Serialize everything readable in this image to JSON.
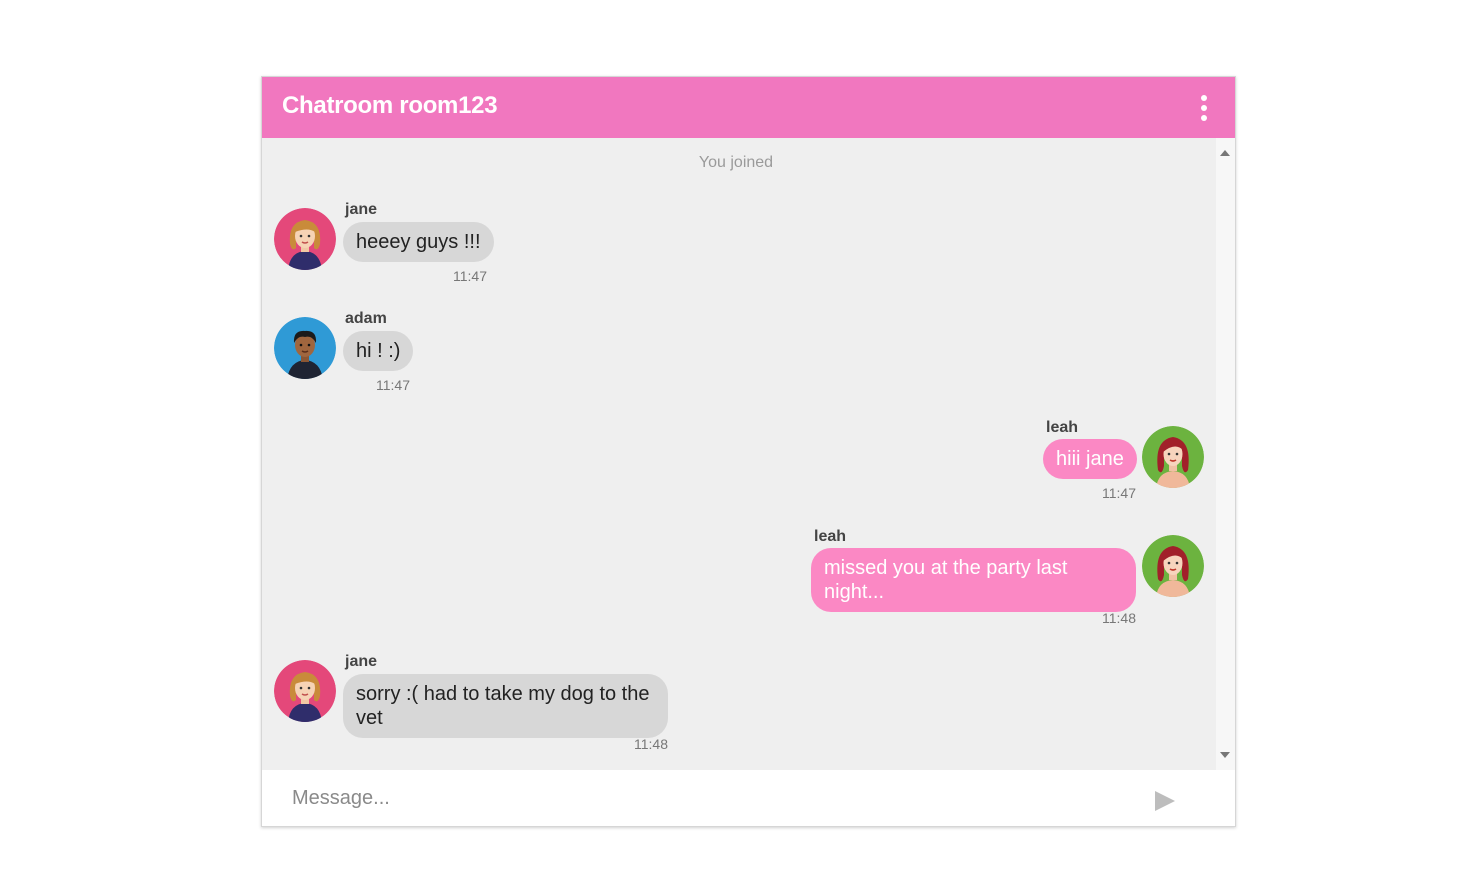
{
  "header": {
    "title": "Chatroom room123",
    "menu_icon": "more-vertical-icon",
    "color": "#f177bf"
  },
  "system_message": "You joined",
  "messages": [
    {
      "sender": "jane",
      "text": "heeey guys !!!",
      "time": "11:47",
      "direction": "in",
      "avatar": "jane-avatar"
    },
    {
      "sender": "adam",
      "text": "hi ! :)",
      "time": "11:47",
      "direction": "in",
      "avatar": "adam-avatar"
    },
    {
      "sender": "leah",
      "text": "hiii jane",
      "time": "11:47",
      "direction": "out",
      "avatar": "leah-avatar"
    },
    {
      "sender": "leah",
      "text": "missed you at the party last night...",
      "time": "11:48",
      "direction": "out",
      "avatar": "leah-avatar"
    },
    {
      "sender": "jane",
      "text": "sorry :( had to take my dog to the vet",
      "time": "11:48",
      "direction": "in",
      "avatar": "jane-avatar"
    }
  ],
  "composer": {
    "placeholder": "Message...",
    "value": "",
    "send_icon": "send-icon"
  },
  "colors": {
    "incoming_bubble": "#d7d7d7",
    "outgoing_bubble": "#fb88c4",
    "background": "#efefef"
  }
}
